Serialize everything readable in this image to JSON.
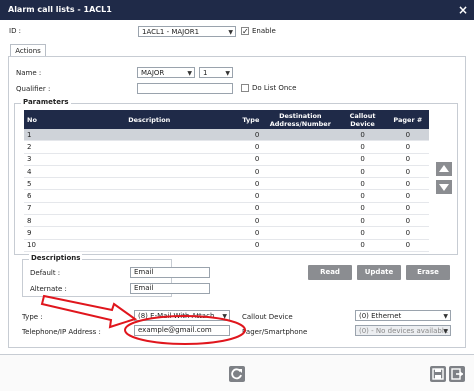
{
  "window": {
    "title": "Alarm call lists - 1ACL1",
    "close_glyph": "×"
  },
  "form": {
    "id_label": "ID :",
    "id_value": "1ACL1 - MAJOR1",
    "enable_label": "Enable",
    "enable_checked": true
  },
  "tabs": [
    {
      "label": "Actions"
    }
  ],
  "actions": {
    "name_label": "Name :",
    "name_value": "MAJOR",
    "name_index": "1",
    "qualifier_label": "Qualifier :",
    "qualifier_value": "",
    "do_list_once_label": "Do List Once"
  },
  "parameters": {
    "legend": "Parameters",
    "columns": [
      "No",
      "Description",
      "Type",
      "Destination Address/Number",
      "Callout Device",
      "Pager #"
    ],
    "rows": [
      {
        "no": "1",
        "desc": "",
        "type": "0",
        "dest": "",
        "callout": "0",
        "pager": "0"
      },
      {
        "no": "2",
        "desc": "",
        "type": "0",
        "dest": "",
        "callout": "0",
        "pager": "0"
      },
      {
        "no": "3",
        "desc": "",
        "type": "0",
        "dest": "",
        "callout": "0",
        "pager": "0"
      },
      {
        "no": "4",
        "desc": "",
        "type": "0",
        "dest": "",
        "callout": "0",
        "pager": "0"
      },
      {
        "no": "5",
        "desc": "",
        "type": "0",
        "dest": "",
        "callout": "0",
        "pager": "0"
      },
      {
        "no": "6",
        "desc": "",
        "type": "0",
        "dest": "",
        "callout": "0",
        "pager": "0"
      },
      {
        "no": "7",
        "desc": "",
        "type": "0",
        "dest": "",
        "callout": "0",
        "pager": "0"
      },
      {
        "no": "8",
        "desc": "",
        "type": "0",
        "dest": "",
        "callout": "0",
        "pager": "0"
      },
      {
        "no": "9",
        "desc": "",
        "type": "0",
        "dest": "",
        "callout": "0",
        "pager": "0"
      },
      {
        "no": "10",
        "desc": "",
        "type": "0",
        "dest": "",
        "callout": "0",
        "pager": "0"
      }
    ],
    "selected_row": "1"
  },
  "descriptions": {
    "legend": "Descriptions",
    "default_label": "Default :",
    "default_value": "Email",
    "alternate_label": "Alternate :",
    "alternate_value": "Email"
  },
  "buttons": {
    "read": "Read",
    "update": "Update",
    "erase": "Erase"
  },
  "entry": {
    "type_label": "Type :",
    "type_value": "(8) E-Mail With Attach",
    "telephone_label": "Telephone/IP Address :",
    "telephone_value": "example@gmail.com",
    "callout_device_label": "Callout Device",
    "callout_device_value": "(0) Ethernet",
    "pager_label": "Pager/Smartphone",
    "pager_value": "(0) - No devices available"
  },
  "colors": {
    "header": "#1f2a48",
    "button": "#8b8d91",
    "annotation": "#e0161d"
  }
}
